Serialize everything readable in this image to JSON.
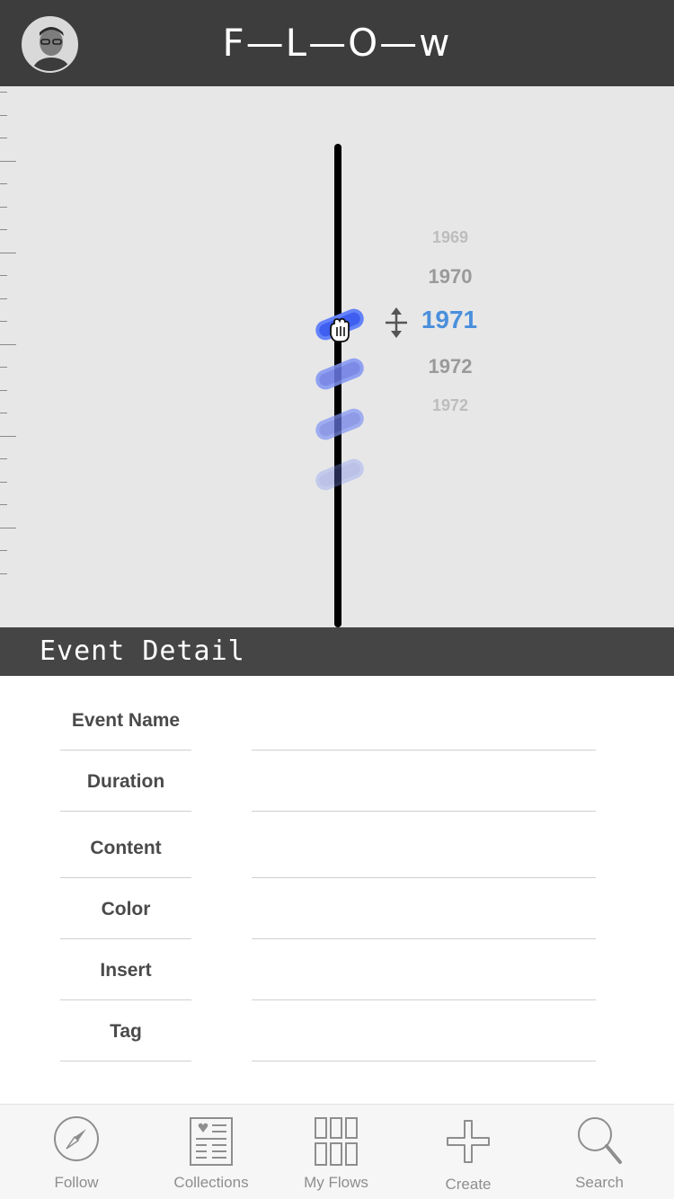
{
  "header": {
    "title": "F—L—O—w",
    "avatar_icon": "user-avatar"
  },
  "timeline": {
    "years": [
      {
        "label": "1969",
        "state": "far"
      },
      {
        "label": "1970",
        "state": "near"
      },
      {
        "label": "1971",
        "state": "selected"
      },
      {
        "label": "1972",
        "state": "near"
      },
      {
        "label": "1972",
        "state": "far"
      }
    ],
    "selected_year": "1971",
    "accent_color": "#4a8fdc",
    "marker_color": "#6b7ce8",
    "move_icon": "move-vertical-icon",
    "cursor_icon": "grab-hand-icon"
  },
  "detail": {
    "title": "Event Detail",
    "fields": [
      {
        "label": "Event Name",
        "value": ""
      },
      {
        "label": "Duration",
        "value": ""
      },
      {
        "label": "Content",
        "value": ""
      },
      {
        "label": "Color",
        "value": ""
      },
      {
        "label": "Insert",
        "value": ""
      },
      {
        "label": "Tag",
        "value": ""
      }
    ]
  },
  "tabbar": {
    "tabs": [
      {
        "label": "Follow",
        "icon": "compass-icon"
      },
      {
        "label": "Collections",
        "icon": "collections-icon"
      },
      {
        "label": "My Flows",
        "icon": "grid-icon"
      },
      {
        "label": "Create",
        "icon": "plus-icon"
      },
      {
        "label": "Search",
        "icon": "search-icon"
      }
    ]
  }
}
